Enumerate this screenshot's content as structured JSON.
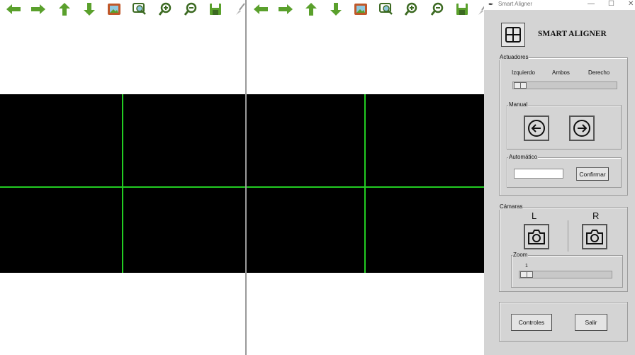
{
  "left_pane": {
    "toolbar": [
      "arrow-left-icon",
      "arrow-right-icon",
      "arrow-up-icon",
      "arrow-down-icon",
      "image-icon",
      "zoom-region-icon",
      "zoom-in-icon",
      "zoom-out-icon",
      "save-icon",
      "brush-icon"
    ]
  },
  "right_pane": {
    "toolbar": [
      "arrow-left-icon",
      "arrow-right-icon",
      "arrow-up-icon",
      "arrow-down-icon",
      "image-icon",
      "zoom-region-icon",
      "zoom-in-icon",
      "zoom-out-icon",
      "save-icon",
      "brush-icon"
    ]
  },
  "window": {
    "title": "Smart Aligner",
    "minimize": "—",
    "maximize": "☐",
    "close": "✕"
  },
  "app": {
    "title": "SMART ALIGNER"
  },
  "actuadores": {
    "legend": "Actuadores",
    "left_label": "Izquierdo",
    "both_label": "Ambos",
    "right_label": "Derecho",
    "selector_value": 0,
    "manual": {
      "legend": "Manual"
    },
    "automatico": {
      "legend": "Automático",
      "input_value": "",
      "confirm_label": "Confirmar"
    }
  },
  "camaras": {
    "legend": "Cámaras",
    "left_letter": "L",
    "right_letter": "R",
    "zoom": {
      "legend": "Zoom",
      "value_label": "1",
      "value": 1
    }
  },
  "footer": {
    "controles_label": "Controles",
    "salir_label": "Salir"
  },
  "colors": {
    "toolbar_icon_green": "#5aa02c",
    "crosshair": "#22cc22",
    "feed": "#000000",
    "window_bg": "#d4d4d4"
  }
}
